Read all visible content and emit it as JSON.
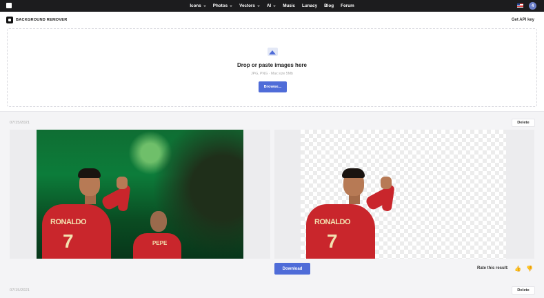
{
  "nav": {
    "items": [
      {
        "label": "Icons",
        "dropdown": true
      },
      {
        "label": "Photos",
        "dropdown": true
      },
      {
        "label": "Vectors",
        "dropdown": true
      },
      {
        "label": "AI",
        "dropdown": true
      },
      {
        "label": "Music",
        "dropdown": false
      },
      {
        "label": "Lunacy",
        "dropdown": false
      },
      {
        "label": "Blog",
        "dropdown": false
      },
      {
        "label": "Forum",
        "dropdown": false
      }
    ],
    "avatar_initial": "4"
  },
  "header": {
    "title": "BACKGROUND REMOVER",
    "api_key": "Get API key"
  },
  "dropzone": {
    "title": "Drop or paste images here",
    "hint": "JPG, PNG · Max size 5Mb",
    "browse_label": "Browse..."
  },
  "results": [
    {
      "date": "07/15/2021",
      "delete_label": "Delete",
      "jersey_name": "RONALDO",
      "jersey_number": "7",
      "second_player_name": "PEPE",
      "download_label": "Download",
      "rate_label": "Rate this result:"
    },
    {
      "date": "07/15/2021",
      "delete_label": "Delete"
    }
  ],
  "colors": {
    "accent": "#4f6cd8",
    "nav_bg": "#1c1c1e",
    "jersey_red": "#c9262c",
    "pitch_green": "#0c7c3a"
  }
}
